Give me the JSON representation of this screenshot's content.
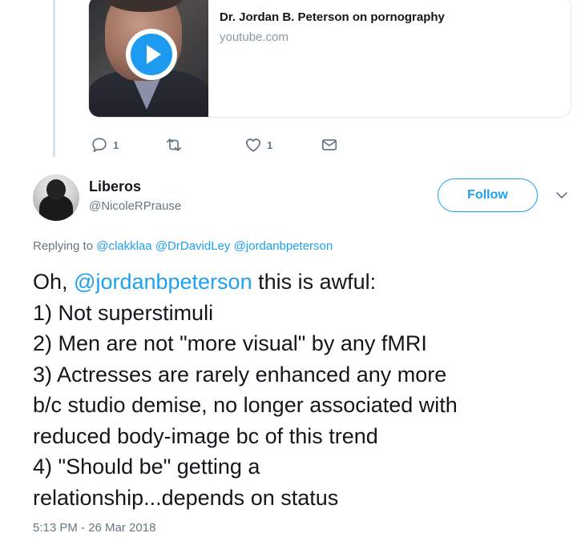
{
  "link_card": {
    "title": "Dr. Jordan B. Peterson on pornography",
    "domain": "youtube.com",
    "thumbnail_icon": "play-icon"
  },
  "parent_actions": {
    "reply_count": "1",
    "retweet_count": "",
    "like_count": "1"
  },
  "tweet": {
    "display_name": "Liberos",
    "handle": "@NicoleRPrause",
    "follow_label": "Follow",
    "replying_prefix": "Replying to",
    "replying_to": [
      "@clakklaa",
      "@DrDavidLey",
      "@jordanbpeterson"
    ],
    "body": {
      "l1_prefix": "Oh, ",
      "l1_mention": "@jordanbpeterson",
      "l1_suffix": " this is awful:",
      "l2": "1) Not superstimuli",
      "l3": "2) Men are not \"more visual\" by any fMRI",
      "l4": "3) Actresses are rarely enhanced any more",
      "l5": "b/c studio demise, no longer associated with",
      "l6": "reduced body-image bc of this trend",
      "l7": "4) \"Should be\" getting a",
      "l8": "relationship...depends on status"
    },
    "timestamp": "5:13 PM - 26 Mar 2018"
  },
  "colors": {
    "accent": "#1da1f2",
    "muted": "#657786",
    "text": "#14171a",
    "thread_line": "#cfe3f4"
  }
}
